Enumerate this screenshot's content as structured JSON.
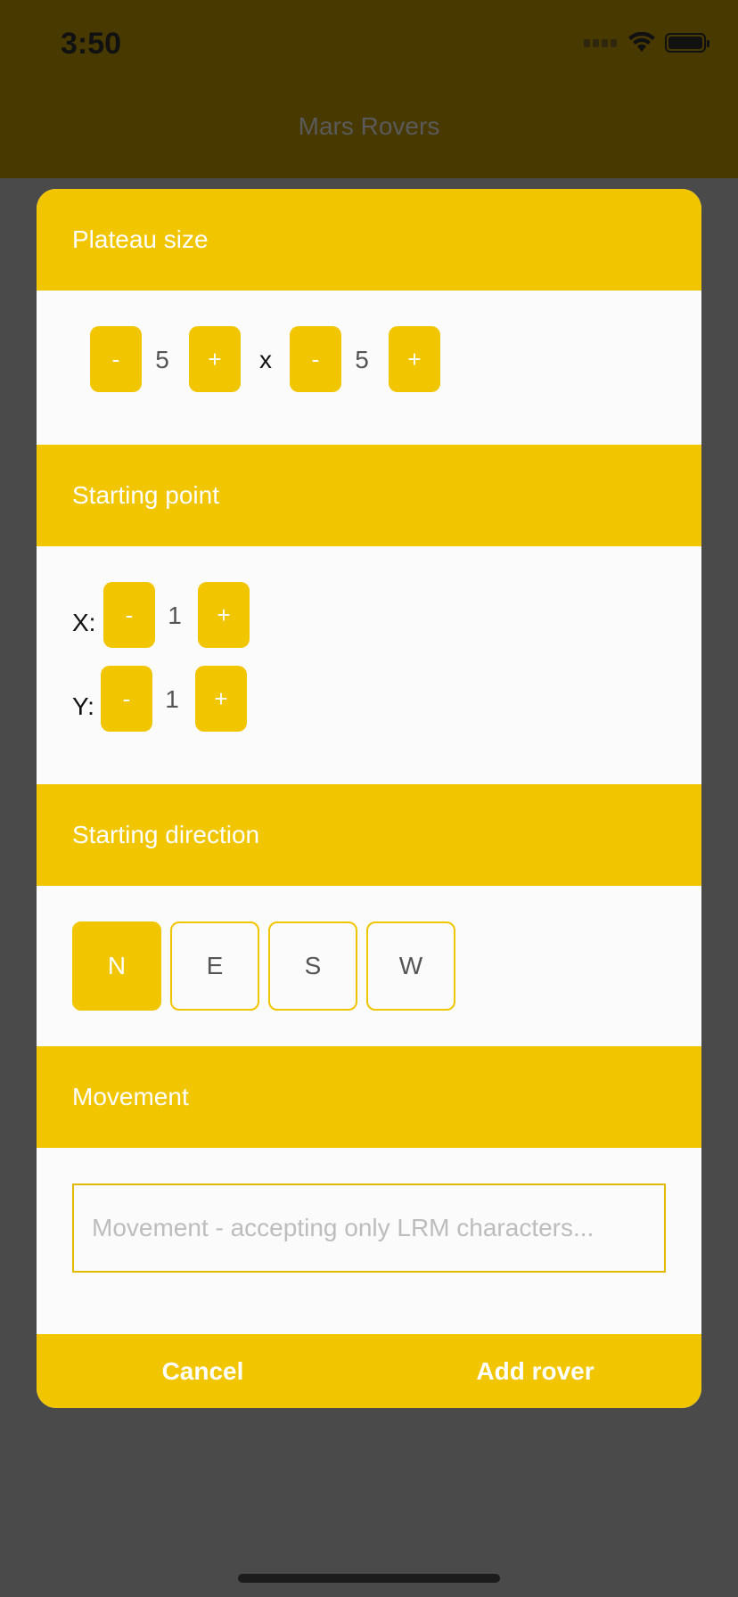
{
  "status_bar": {
    "time": "3:50"
  },
  "nav": {
    "title": "Mars Rovers"
  },
  "plateau": {
    "title": "Plateau size",
    "width": "5",
    "height": "5",
    "separator": "x",
    "minus": "-",
    "plus": "+"
  },
  "start_point": {
    "title": "Starting point",
    "x_label": "X:",
    "x_value": "1",
    "y_label": "Y:",
    "y_value": "1",
    "minus": "-",
    "plus": "+"
  },
  "direction": {
    "title": "Starting direction",
    "options": [
      "N",
      "E",
      "S",
      "W"
    ],
    "selected": "N"
  },
  "movement": {
    "title": "Movement",
    "placeholder": "Movement - accepting only LRM characters...",
    "value": ""
  },
  "footer": {
    "cancel_label": "Cancel",
    "add_label": "Add rover"
  },
  "colors": {
    "accent": "#f1c500",
    "header_bg": "#473900",
    "overlay_bg": "#4a4a4a"
  }
}
